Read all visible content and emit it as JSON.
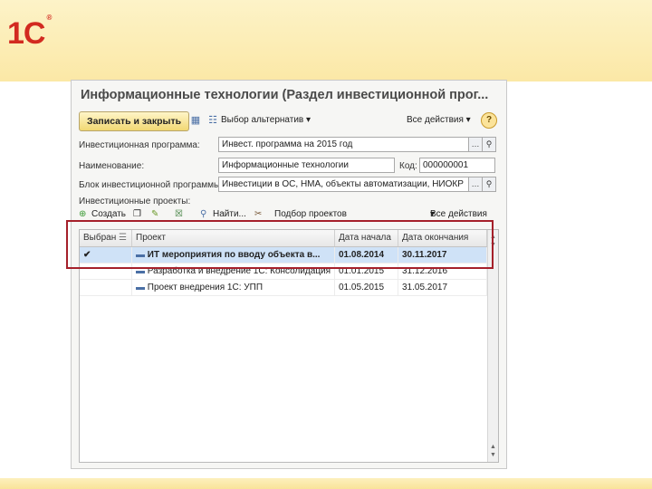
{
  "slide": {
    "logo": "1С",
    "logo_mark": "®"
  },
  "window": {
    "title": "Информационные технологии (Раздел инвестиционной прог...",
    "toolbar": {
      "save_close": "Записать и закрыть",
      "choose_alternative": "Выбор альтернатив",
      "all_actions": "Все действия",
      "help": "?"
    },
    "fields": {
      "program_label": "Инвестиционная программа:",
      "program_value": "Инвест. программа на 2015 год",
      "name_label": "Наименование:",
      "name_value": "Информационные технологии",
      "code_label": "Код:",
      "code_value": "000000001",
      "block_label": "Блок инвестиционной программы:",
      "block_value": "Инвестиции в ОС, НМА, объекты автоматизации, НИОКР",
      "projects_label": "Инвестиционные проекты:"
    },
    "projects_toolbar": {
      "create": "Создать",
      "find": "Найти...",
      "select_projects": "Подбор проектов",
      "all_actions": "Все действия"
    },
    "table": {
      "columns": [
        "Выбран",
        "Проект",
        "Дата начала",
        "Дата окончания"
      ],
      "rows": [
        {
          "selected": "✔",
          "project": "ИТ мероприятия по вводу объекта в...",
          "start": "01.08.2014",
          "end": "30.11.2017"
        },
        {
          "selected": "",
          "project": "Разработка и внедрение 1С: Консолидация",
          "start": "01.01.2015",
          "end": "31.12.2016"
        },
        {
          "selected": "",
          "project": "Проект внедрения 1С: УПП",
          "start": "01.05.2015",
          "end": "31.05.2017"
        }
      ]
    }
  }
}
